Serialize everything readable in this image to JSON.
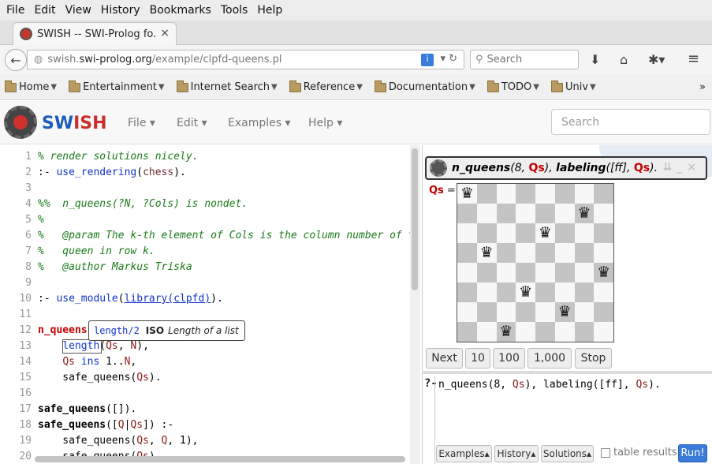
{
  "menubar": {
    "items": [
      "File",
      "Edit",
      "View",
      "History",
      "Bookmarks",
      "Tools",
      "Help"
    ]
  },
  "tab": {
    "title": "SWISH -- SWI-Prolog fo...",
    "close": "×",
    "new_tab": "+"
  },
  "navbar": {
    "url_prefix": "swish.",
    "url_domain": "swi-prolog.org",
    "url_path": "/example/clpfd-queens.pl",
    "search_placeholder": "Search"
  },
  "bookmarks": [
    {
      "label": "Home"
    },
    {
      "label": "Entertainment"
    },
    {
      "label": "Internet Search"
    },
    {
      "label": "Reference"
    },
    {
      "label": "Documentation"
    },
    {
      "label": "TODO"
    },
    {
      "label": "Univ"
    }
  ],
  "bookmarks_more": "»",
  "swish": {
    "brand_sw": "SW",
    "brand_ish": "ISH",
    "menus": [
      "File",
      "Edit",
      "Examples",
      "Help"
    ],
    "search_placeholder": "Search"
  },
  "editor": {
    "line_numbers": [
      "1",
      "2",
      "3",
      "4",
      "5",
      "6",
      "7",
      "8",
      "9",
      "10",
      "11",
      "12",
      "13",
      "14",
      "15",
      "16",
      "17",
      "18",
      "19",
      "20"
    ],
    "tooltip": {
      "pred": "length/2",
      "iso": "ISO",
      "desc": "Length of a list"
    }
  },
  "query": {
    "title_pred": "n_queens",
    "title_args_open": "(8, ",
    "title_var": "Qs",
    "title_mid": "), ",
    "title_label": "labeling",
    "title_open2": "([ff], ",
    "title_var2": "Qs",
    "title_close": ").",
    "result_var": "Qs",
    "result_eq": " =",
    "queen_rows": [
      1,
      4,
      8,
      6,
      3,
      7,
      2,
      5
    ],
    "buttons": [
      "Next",
      "10",
      "100",
      "1,000",
      "Stop"
    ],
    "prompt": "?-",
    "input_a": "n_queens(8, ",
    "input_var": "Qs",
    "input_b": "), labeling([ff], ",
    "input_var2": "Qs",
    "input_c": ").",
    "bottom_buttons": [
      "Examples▴",
      "History▴",
      "Solutions▴"
    ],
    "table_results": "table results",
    "run": "Run!"
  }
}
